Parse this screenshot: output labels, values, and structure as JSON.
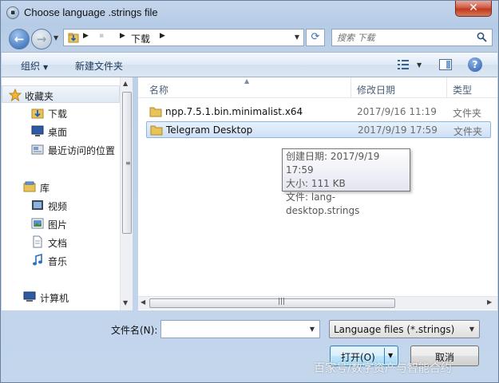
{
  "window": {
    "title": "Choose language .strings file",
    "close_label": "✕"
  },
  "nav": {
    "breadcrumb": [
      "下载"
    ],
    "search_placeholder": "搜索 下载"
  },
  "toolbar": {
    "organize_label": "组织",
    "new_folder_label": "新建文件夹"
  },
  "sidebar": {
    "items": [
      {
        "label": "收藏夹",
        "icon": "star-icon"
      },
      {
        "label": "下载",
        "icon": "download-folder-icon"
      },
      {
        "label": "桌面",
        "icon": "desktop-icon"
      },
      {
        "label": "最近访问的位置",
        "icon": "recent-places-icon"
      },
      {
        "label": "库",
        "icon": "library-icon"
      },
      {
        "label": "视频",
        "icon": "video-icon"
      },
      {
        "label": "图片",
        "icon": "pictures-icon"
      },
      {
        "label": "文档",
        "icon": "documents-icon"
      },
      {
        "label": "音乐",
        "icon": "music-icon"
      },
      {
        "label": "计算机",
        "icon": "computer-icon"
      }
    ]
  },
  "filelist": {
    "columns": {
      "name": "名称",
      "modified": "修改日期",
      "type": "类型"
    },
    "rows": [
      {
        "name": "npp.7.5.1.bin.minimalist.x64",
        "modified": "2017/9/16 11:19",
        "type": "文件夹"
      },
      {
        "name": "Telegram Desktop",
        "modified": "2017/9/19 17:59",
        "type": "文件夹"
      }
    ]
  },
  "tooltip": {
    "created": "创建日期: 2017/9/19 17:59",
    "size": "大小: 111 KB",
    "files": "文件: lang-desktop.strings"
  },
  "bottom": {
    "filename_label": "文件名(N):",
    "filename_value": "",
    "filetype_value": "Language files (*.strings)",
    "open_label": "打开(O)",
    "cancel_label": "取消"
  },
  "watermark": "百家号/数字资产与智能合约"
}
